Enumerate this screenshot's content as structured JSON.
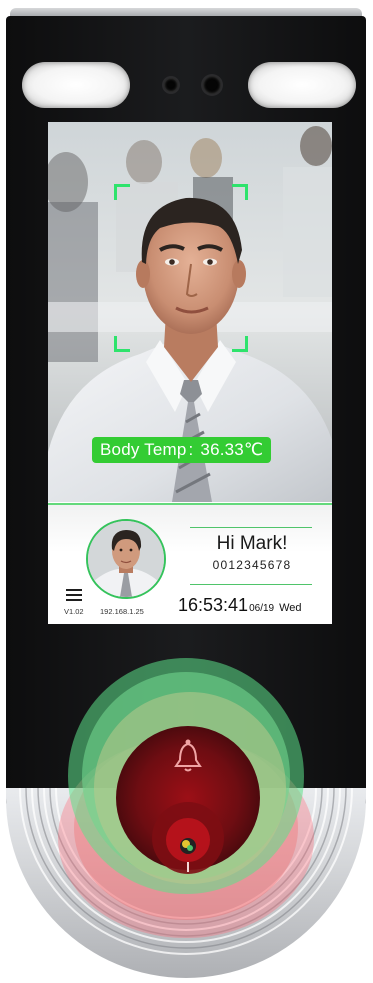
{
  "screen": {
    "temperature": {
      "label": "Body Temp",
      "separator": ":",
      "value": "36.33",
      "unit": "℃"
    },
    "user": {
      "greeting": "Hi Mark!",
      "employee_id": "0012345678"
    },
    "status": {
      "version": "V1.02",
      "ip_address": "192.168.1.25",
      "time": "16:53:41",
      "date": "06/19",
      "weekday": "Wed"
    }
  },
  "colors": {
    "accent_green": "#33cc33",
    "face_frame_green": "#2ee36c",
    "alert_red": "#c4161c"
  },
  "icons": {
    "menu": "menu-icon",
    "bell": "bell-icon",
    "scanner": "fingerprint-sensor-icon"
  }
}
